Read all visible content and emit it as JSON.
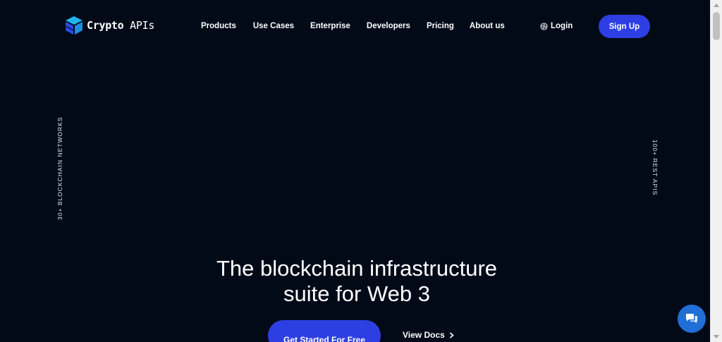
{
  "header": {
    "logo_bold": "Crypto",
    "logo_light": "APIs",
    "nav": [
      {
        "label": "Products"
      },
      {
        "label": "Use Cases"
      },
      {
        "label": "Enterprise"
      },
      {
        "label": "Developers"
      },
      {
        "label": "Pricing"
      },
      {
        "label": "About us"
      }
    ],
    "login_label": "Login",
    "signup_label": "Sign Up"
  },
  "side_labels": {
    "left": "30+ BLOCKCHAIN NETWORKS",
    "right": "100+ REST APIS"
  },
  "hero": {
    "title_line1": "The blockchain infrastructure",
    "title_line2": "suite for Web 3",
    "primary_cta": "Get Started For Free",
    "secondary_cta": "View Docs"
  },
  "icons": {
    "logo": "cube-logo-icon",
    "login": "fingerprint-icon",
    "docs": "chevron-right-icon",
    "chat": "chat-bubble-icon"
  },
  "colors": {
    "background": "#020A18",
    "accent": "#2D3FE3",
    "chat": "#1F6FD6",
    "logo_cyan": "#1FB6F0",
    "logo_blue": "#2D4BE8"
  }
}
